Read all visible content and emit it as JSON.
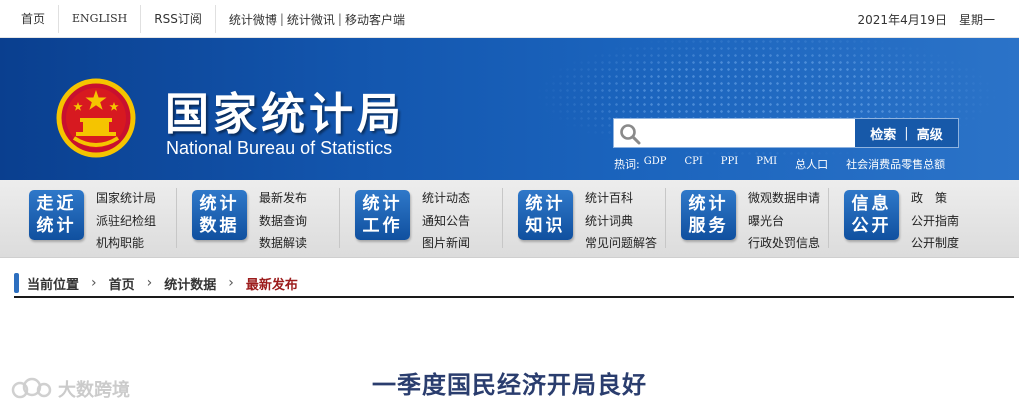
{
  "topbar": {
    "links": [
      "首页",
      "ENGLISH",
      "RSS订阅"
    ],
    "social": [
      "统计微博",
      "统计微讯",
      "移动客户端"
    ],
    "date": "2021年4月19日",
    "weekday": "星期一"
  },
  "banner": {
    "title_cn": "国家统计局",
    "title_en": "National Bureau of Statistics",
    "search": {
      "value": "",
      "placeholder": "",
      "search_label": "检索",
      "advanced_label": "高级"
    },
    "hot": {
      "label": "热词:",
      "terms": [
        "GDP",
        "CPI",
        "PPI",
        "PMI",
        "总人口",
        "社会消费品零售总额"
      ]
    }
  },
  "nav": [
    {
      "box": [
        "走近",
        "统计"
      ],
      "links": [
        "国家统计局",
        "派驻纪检组",
        "机构职能"
      ]
    },
    {
      "box": [
        "统计",
        "数据"
      ],
      "links": [
        "最新发布",
        "数据查询",
        "数据解读"
      ]
    },
    {
      "box": [
        "统计",
        "工作"
      ],
      "links": [
        "统计动态",
        "通知公告",
        "图片新闻"
      ]
    },
    {
      "box": [
        "统计",
        "知识"
      ],
      "links": [
        "统计百科",
        "统计词典",
        "常见问题解答"
      ]
    },
    {
      "box": [
        "统计",
        "服务"
      ],
      "links": [
        "微观数据申请",
        "曝光台",
        "行政处罚信息"
      ]
    },
    {
      "box": [
        "信息",
        "公开"
      ],
      "links": [
        "政　策",
        "公开指南",
        "公开制度"
      ]
    }
  ],
  "breadcrumb": {
    "label": "当前位置",
    "items": [
      "首页",
      "统计数据"
    ],
    "current": "最新发布"
  },
  "article": {
    "title": "一季度国民经济开局良好"
  },
  "watermark": {
    "text": "大数跨境"
  },
  "colors": {
    "banner_blue": "#1356ae",
    "nav_box_blue": "#1f66b8",
    "current_crumb": "#9c1c1c",
    "title_navy": "#2a3d6e"
  }
}
